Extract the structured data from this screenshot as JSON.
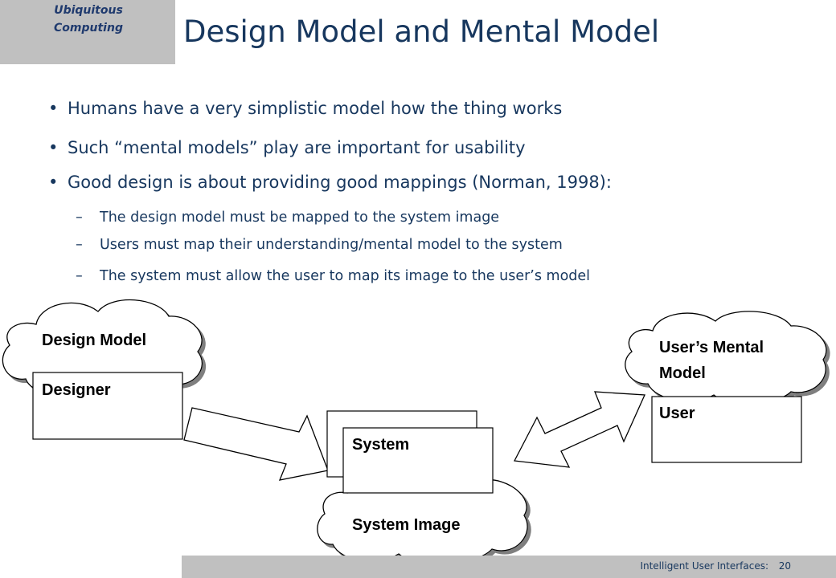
{
  "header": {
    "course_tag": "Ubiquitous Computing",
    "title": "Design Model and Mental Model"
  },
  "bullets": [
    {
      "text": "Humans have a very simplistic model how the thing works",
      "sub": []
    },
    {
      "text": "Such “mental models” play are important for usability",
      "sub": []
    },
    {
      "text": "Good design is about providing good mappings (Norman, 1998):",
      "sub": [
        "The design model must be mapped to the system image",
        "Users must map their understanding/mental model to the system",
        "The system must allow the user to map its image to the user’s model"
      ]
    }
  ],
  "diagram": {
    "design_model_label": "Design Model",
    "designer_label": "Designer",
    "system_label": "System",
    "system_image_label": "System Image",
    "users_mental_model_line1": "User’s Mental",
    "users_mental_model_line2": "Model",
    "user_label": "User"
  },
  "footer": {
    "course": "Intelligent User Interfaces:",
    "page": "20"
  },
  "colors": {
    "title_text": "#17375e",
    "tag_background": "#c0c0c0",
    "footer_background": "#c0c0c0"
  }
}
